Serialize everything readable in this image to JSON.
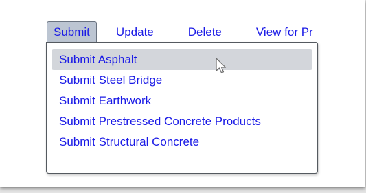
{
  "menubar": {
    "items": [
      {
        "label": "Submit"
      },
      {
        "label": "Update"
      },
      {
        "label": "Delete"
      },
      {
        "label": "View for Pr"
      }
    ]
  },
  "dropdown": {
    "items": [
      {
        "label": "Submit Asphalt"
      },
      {
        "label": "Submit Steel Bridge"
      },
      {
        "label": "Submit Earthwork"
      },
      {
        "label": "Submit Prestressed Concrete Products"
      },
      {
        "label": "Submit Structural Concrete"
      }
    ]
  },
  "colors": {
    "link": "#1a1ae6",
    "active_tab": "#bcc5d2",
    "hover_row": "#d3d6db"
  },
  "icons": {
    "cursor": "mouse-pointer-icon"
  }
}
